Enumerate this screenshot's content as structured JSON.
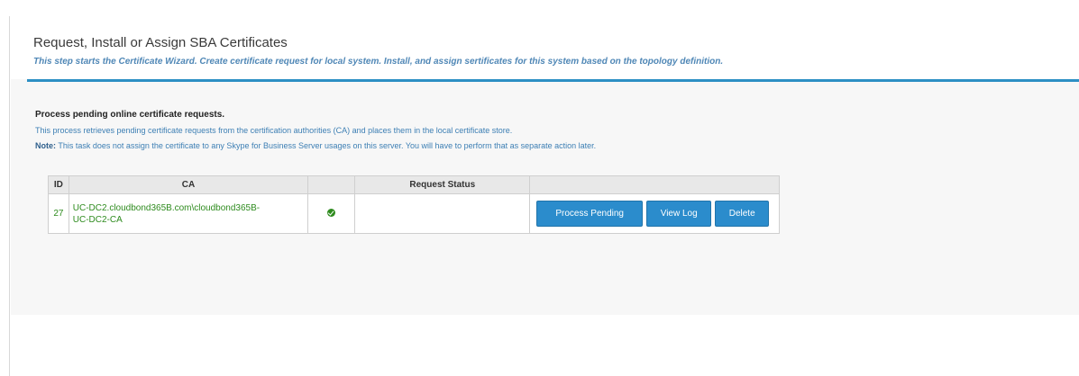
{
  "header": {
    "title": "Request, Install or Assign SBA Certificates",
    "subtitle": "This step starts the Certificate Wizard. Create certificate request for local system. Install, and assign sertificates for this system based on the topology definition."
  },
  "section": {
    "title": "Process pending online certificate requests.",
    "description": "This process retrieves pending certificate requests from the certification authorities (CA) and places them in the local certificate store.",
    "note_label": "Note:",
    "note_text": " This task does not assign the certificate to any Skype for Business Server usages on this server. You will have to perform that as separate action later."
  },
  "table": {
    "headers": {
      "id": "ID",
      "ca": "CA",
      "request_status": "Request Status"
    },
    "rows": [
      {
        "id": "27",
        "ca_line1": "UC-DC2.cloudbond365B.com\\cloudbond365B-",
        "ca_line2": "UC-DC2-CA",
        "status_icon": "check-circle-icon",
        "status_text": ""
      }
    ]
  },
  "buttons": {
    "process_pending": "Process Pending",
    "view_log": "View Log",
    "delete": "Delete"
  },
  "colors": {
    "accent": "#2b8ccc",
    "rule": "#2d8fc4",
    "ca_text": "#2e8b1e",
    "info_text": "#3d7fb4"
  }
}
